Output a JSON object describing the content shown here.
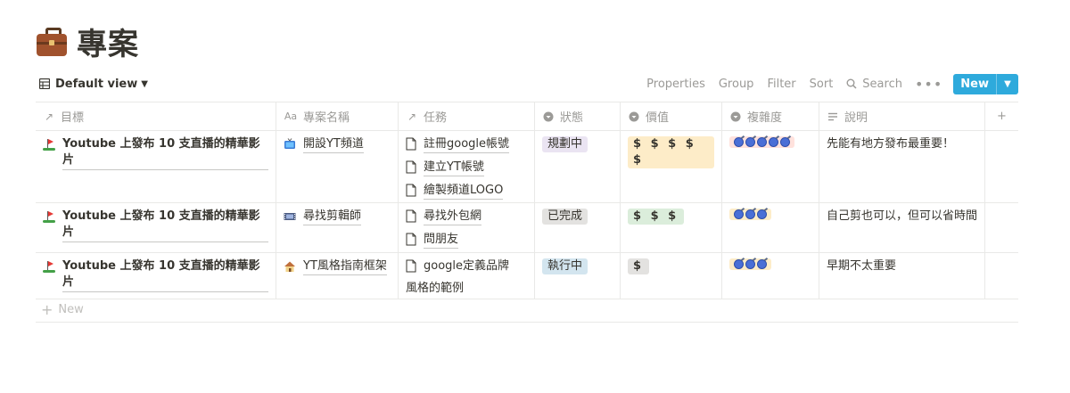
{
  "page": {
    "title": "專案"
  },
  "toolbar": {
    "view_label": "Default view",
    "properties": "Properties",
    "group": "Group",
    "filter": "Filter",
    "sort": "Sort",
    "search": "Search",
    "more": "•••",
    "new_label": "New"
  },
  "columns": [
    {
      "name": "目標",
      "icon": "relation-arrow-icon"
    },
    {
      "name": "專案名稱",
      "icon": "title-aa-icon"
    },
    {
      "name": "任務",
      "icon": "relation-arrow-icon"
    },
    {
      "name": "狀態",
      "icon": "select-icon"
    },
    {
      "name": "價值",
      "icon": "select-icon"
    },
    {
      "name": "複雜度",
      "icon": "select-icon"
    },
    {
      "name": "說明",
      "icon": "text-lines-icon"
    }
  ],
  "rows": [
    {
      "goal": "Youtube 上發布 10 支直播的精華影片",
      "project": "開設YT頻道",
      "project_icon": "tv-icon",
      "tasks": [
        "註冊google帳號",
        "建立YT帳號",
        "繪製頻道LOGO"
      ],
      "status": "規劃中",
      "value": "$ $ $ $ $",
      "complexity": 5,
      "desc": "先能有地方發布最重要！"
    },
    {
      "goal": "Youtube 上發布 10 支直播的精華影片",
      "project": "尋找剪輯師",
      "project_icon": "film-icon",
      "tasks": [
        "尋找外包網",
        "問朋友"
      ],
      "status": "已完成",
      "value": "$ $ $",
      "complexity": 3,
      "desc": "自己剪也可以，但可以省時間"
    },
    {
      "goal": "Youtube 上發布 10 支直播的精華影片",
      "project": "YT風格指南框架",
      "project_icon": "house-icon",
      "tasks": [
        "google定義品牌",
        "風格的範例"
      ],
      "status": "執行中",
      "value": "$",
      "complexity": 3,
      "desc": "早期不太重要"
    }
  ],
  "new_row_label": "New",
  "colors": {
    "accent": "#2eaadc",
    "status_planning_bg": "#eae4f2",
    "status_done_bg": "#e3e2e0",
    "status_doing_bg": "#d3e5ef",
    "value_5_bg": "#fdecc8",
    "value_3_bg": "#dbeddb",
    "value_1_bg": "#e3e2e0",
    "complex_5_bg": "#ffe2dd",
    "complex_3_bg": "#fdecc8"
  }
}
